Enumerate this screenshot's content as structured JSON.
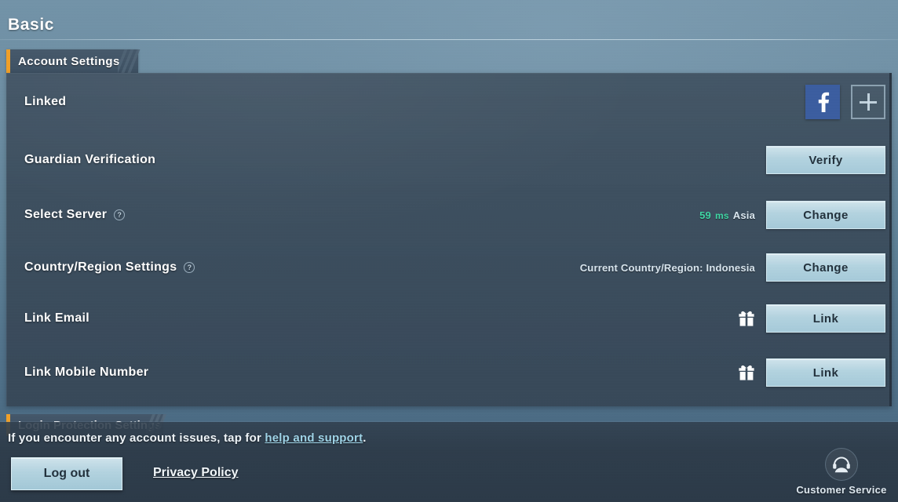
{
  "header": {
    "title": "Basic"
  },
  "tabs": [
    {
      "label": "Account Settings",
      "active": true
    },
    {
      "label": "Login Protection Settings",
      "active": false
    }
  ],
  "colors": {
    "accent_orange": "#f0a028",
    "button_blue": "#b3d3e0",
    "facebook_blue": "#3b5da0",
    "ping_green": "#3fd6a4",
    "link_blue": "#9fd4e8",
    "panel_bg": "#3a4b5b",
    "page_bg": "#6d8ea3"
  },
  "rows": [
    {
      "label": "Linked",
      "help": false,
      "meta": "",
      "type": "social",
      "social": {
        "facebook_icon": "facebook-icon",
        "add_icon": "plus-icon"
      }
    },
    {
      "label": "Guardian Verification",
      "help": false,
      "meta": "",
      "type": "button",
      "button": "Verify"
    },
    {
      "label": "Select Server",
      "help": true,
      "help_icon": "question-mark-icon",
      "type": "button",
      "button": "Change",
      "ping_value": "59",
      "ping_unit": "ms",
      "server_name": "Asia"
    },
    {
      "label": "Country/Region Settings",
      "help": true,
      "help_icon": "question-mark-icon",
      "type": "button",
      "button": "Change",
      "meta": "Current Country/Region: Indonesia"
    },
    {
      "label": "Link Email",
      "help": false,
      "type": "button",
      "button": "Link",
      "gift_icon": "gift-icon"
    },
    {
      "label": "Link Mobile Number",
      "help": false,
      "type": "button",
      "button": "Link",
      "gift_icon": "gift-icon"
    }
  ],
  "bottom": {
    "note_prefix": "If you encounter any account issues, tap for ",
    "note_link": "help and support",
    "note_suffix": ".",
    "logout_label": "Log out",
    "privacy_label": "Privacy Policy",
    "customer_service_label": "Customer Service",
    "customer_service_icon": "headset-agent-icon"
  }
}
